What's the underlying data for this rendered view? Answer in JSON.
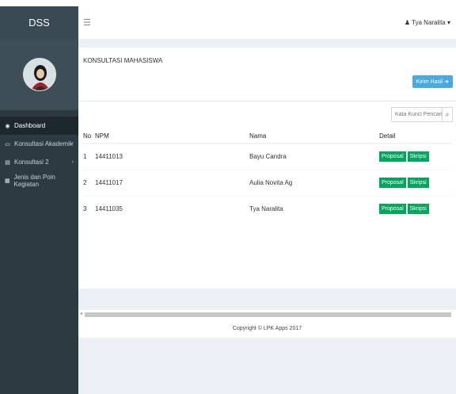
{
  "brand": "DSS",
  "user": {
    "name": "Tya Naralita",
    "caret": "▾"
  },
  "sidebar": {
    "items": [
      {
        "label": "Dashboard",
        "icon": "dashboard-icon",
        "glyph": "◉",
        "chevron": ""
      },
      {
        "label": "Konsultasi Akademik",
        "icon": "laptop-icon",
        "glyph": "▭",
        "chevron": "‹"
      },
      {
        "label": "Konsultasi 2",
        "icon": "book-icon",
        "glyph": "▤",
        "chevron": "‹"
      },
      {
        "label": "Jenis dan Poin Kegiatan",
        "icon": "list-icon",
        "glyph": "▦",
        "chevron": ""
      }
    ]
  },
  "main": {
    "title": "KONSULTASI MAHASISWA",
    "tambah_label": "Kirim Hasil",
    "search": {
      "placeholder": "Kata Kunci Pencarian..."
    },
    "table": {
      "headers": [
        "No",
        "NPM",
        "Nama",
        "Detail"
      ],
      "rows": [
        {
          "no": "1",
          "npm": "14411013",
          "nama": "Bayu Candra"
        },
        {
          "no": "2",
          "npm": "14411017",
          "nama": "Aulia Novita Ag"
        },
        {
          "no": "3",
          "npm": "14411035",
          "nama": "Tya Naralita"
        }
      ],
      "btn_proposal": "Proposal",
      "btn_skripsi": "Skripsi"
    }
  },
  "footer": "Copyright © LPK Apps 2017",
  "colors": {
    "sidebar": "#2c3b41",
    "accent": "#4aa9e0",
    "success": "#00a65a"
  }
}
